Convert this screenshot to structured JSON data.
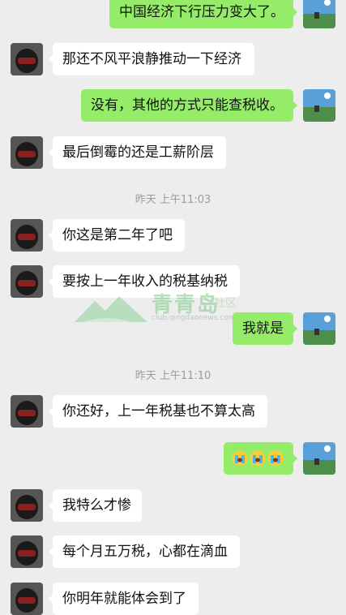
{
  "messages": [
    {
      "side": "right",
      "text": "中国经济下行压力变大了。"
    },
    {
      "side": "left",
      "text": "那还不风平浪静推动一下经济"
    },
    {
      "side": "right",
      "text": "没有，其他的方式只能查税收。"
    },
    {
      "side": "left",
      "text": "最后倒霉的还是工薪阶层"
    },
    {
      "side": "left",
      "text": "你这是第二年了吧"
    },
    {
      "side": "left",
      "text": "要按上一年收入的税基纳税"
    },
    {
      "side": "right",
      "text": "我就是"
    },
    {
      "side": "left",
      "text": "你还好，上一年税基也不算太高"
    },
    {
      "side": "right",
      "emoji": "crying-face-emoji",
      "count": 3
    },
    {
      "side": "left",
      "text": "我特么才惨"
    },
    {
      "side": "left",
      "text": "每个月五万税，心都在滴血"
    },
    {
      "side": "left",
      "text": "你明年就能体会到了"
    }
  ],
  "timestamps": [
    "昨天 上午11:03",
    "昨天 上午11:10"
  ],
  "watermark": {
    "brand": "青青岛",
    "suffix": "社区",
    "url": "club.qingdaonews.com"
  },
  "colors": {
    "background": "#ededed",
    "bubble_left": "#ffffff",
    "bubble_right": "#95ec69",
    "timestamp": "#9b9b9b"
  }
}
